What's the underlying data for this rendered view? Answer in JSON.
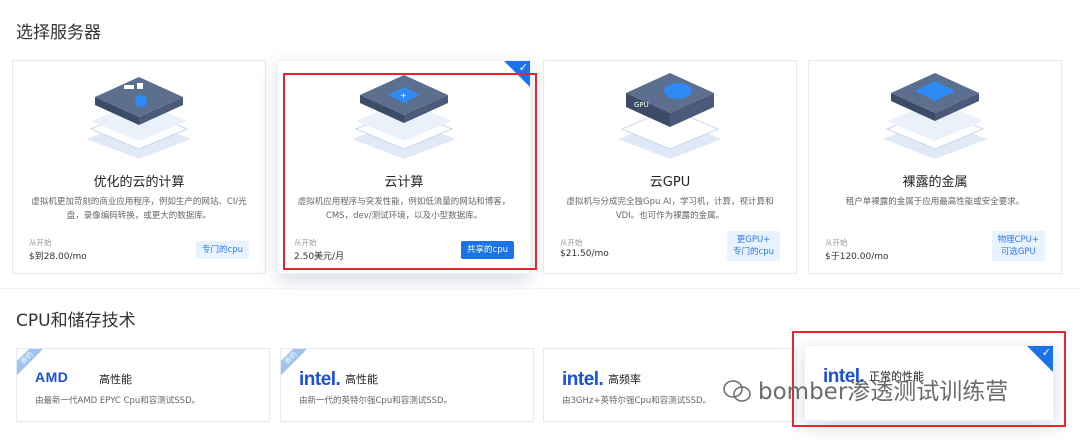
{
  "sections": {
    "server_title": "选择服务器",
    "tech_title": "CPU和储存技术"
  },
  "server_cards": [
    {
      "name": "优化的云的计算",
      "desc": "虚拟机更加苛刻的商业应用程序，例如生产的网站、CI/光盘，录像编码转换，或更大的数据库。",
      "from": "从开始",
      "price": "$到28.00/mo",
      "tag": "专门的cpu"
    },
    {
      "name": "云计算",
      "desc": "虚拟机应用程序与突发性能，例如低流量的网站和博客，CMS，dev/测试环境，以及小型数据库。",
      "from": "从开始",
      "price": "2.50美元/月",
      "tag": "共享的cpu"
    },
    {
      "name": "云GPU",
      "desc": "虚拟机与分成完全独Gpu AI，学习机，计算，视计算和VDI。也可作为裸露的金属。",
      "from": "从开始",
      "price": "$21.50/mo",
      "tag_line1": "更GPU+",
      "tag_line2": "专门的cpu"
    },
    {
      "name": "裸露的金属",
      "desc": "租户单裸露的金属于应用最高性能或安全要求。",
      "from": "从开始",
      "price": "$于120.00/mo",
      "tag_line1": "物理CPU+",
      "tag_line2": "可选GPU"
    }
  ],
  "tech_cards": [
    {
      "badge": "新的",
      "logo": "AMD",
      "title": "高性能",
      "desc": "由最新一代AMD EPYC Cpu和容测试SSD。"
    },
    {
      "badge": "新的",
      "logo": "intel.",
      "title": "高性能",
      "desc": "由新一代的英特尔强Cpu和容测试SSD。"
    },
    {
      "logo": "intel.",
      "title": "高频率",
      "desc": "由3GHz+英特尔强Cpu和容测试SSD。"
    },
    {
      "logo": "intel.",
      "title": "正常的性能"
    }
  ],
  "watermark": "bomber渗透测试训练营",
  "colors": {
    "accent": "#1a73e8",
    "highlight": "#e8242c"
  }
}
